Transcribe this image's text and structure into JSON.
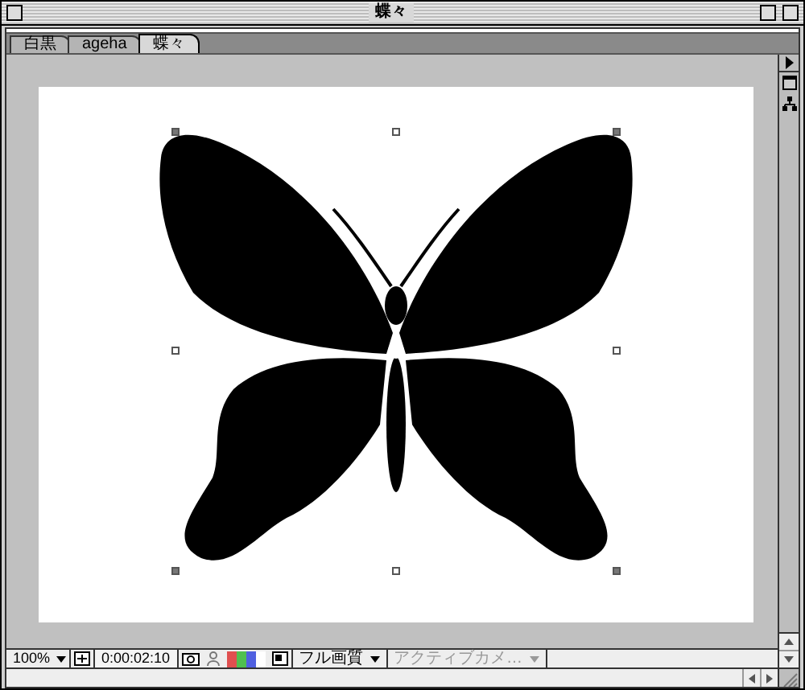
{
  "window": {
    "title": "蝶々"
  },
  "tabs": [
    {
      "label": "白黒",
      "selected": false
    },
    {
      "label": "ageha",
      "selected": false
    },
    {
      "label": "蝶々",
      "selected": true
    }
  ],
  "footer": {
    "zoom": "100%",
    "timecode": "0:00:02:10",
    "resolution": "フル画質",
    "camera": {
      "label": "アクティブカメ…",
      "disabled": true
    }
  }
}
